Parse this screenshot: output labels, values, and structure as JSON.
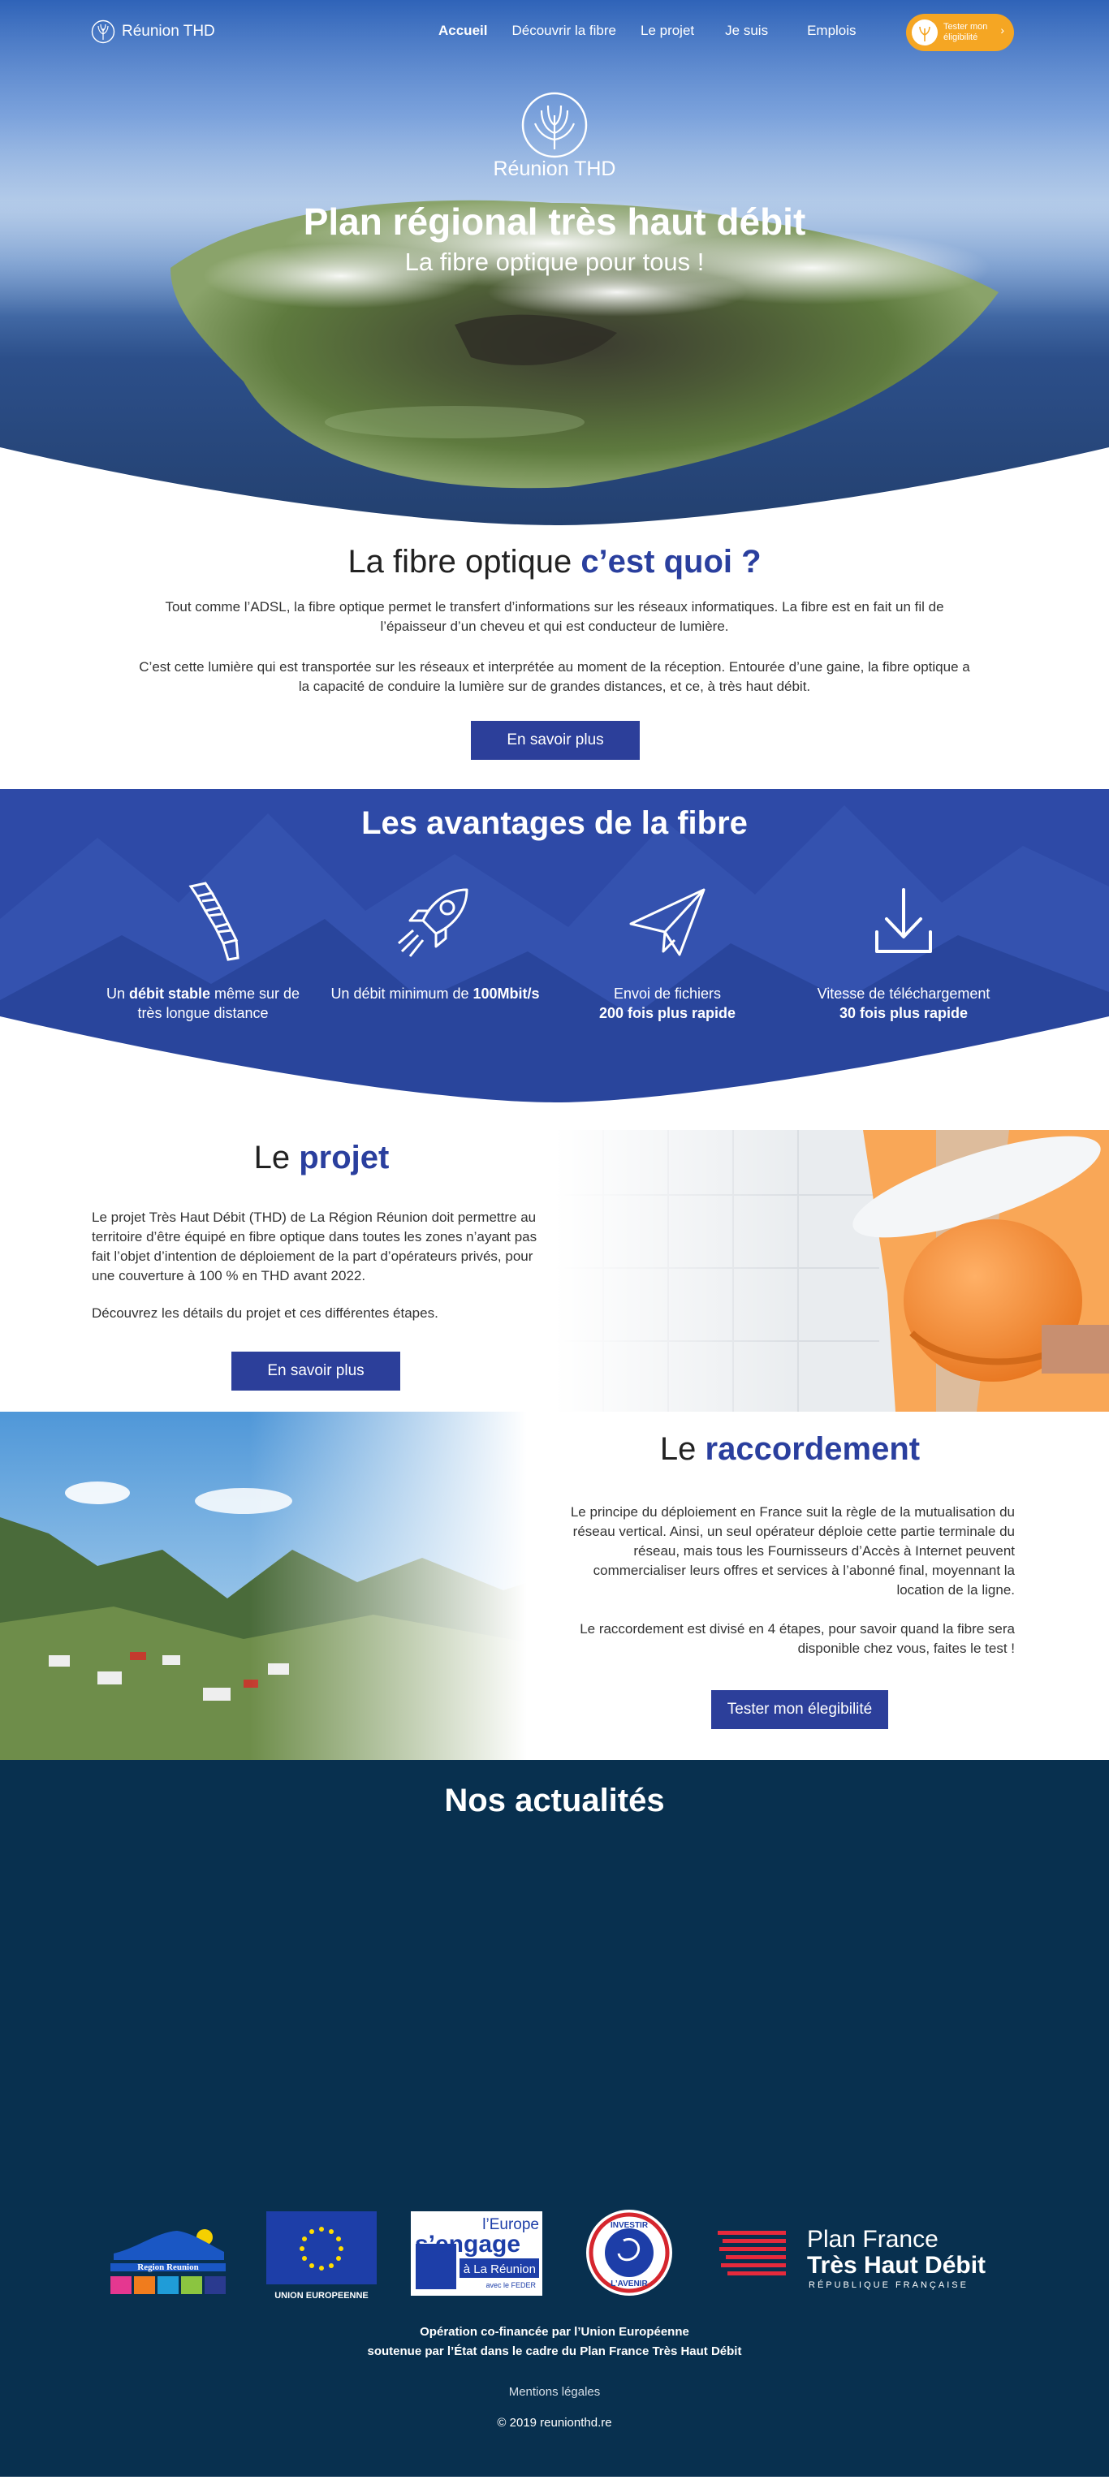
{
  "nav": {
    "brand": "Réunion THD",
    "links": [
      "Accueil",
      "Découvrir la fibre",
      "Le projet",
      "Je suis",
      "Emplois"
    ],
    "cta_line1": "Tester mon",
    "cta_line2": "éligibilité",
    "cta_arrow": "›"
  },
  "hero": {
    "logo_text": "Réunion THD",
    "title": "Plan régional très haut débit",
    "subtitle": "La fibre optique pour tous !"
  },
  "fibre": {
    "title_light": "La fibre optique ",
    "title_bold": "c’est quoi ?",
    "p1": "Tout comme l’ADSL, la fibre optique permet le transfert d’informations sur les réseaux informatiques. La fibre est en fait un fil de l’épaisseur d’un cheveu et qui est conducteur de lumière.",
    "p2": "C’est cette lumière qui est transportée sur les réseaux et interprétée au moment de la réception. Entourée d’une gaine, la fibre optique a la capacité de conduire la lumière sur de grandes distances, et ce, à très haut débit.",
    "button": "En savoir plus"
  },
  "avantages": {
    "title_light": "Les ",
    "title_bold": "avantages de la fibre",
    "items": [
      {
        "icon": "fiber-cable-icon",
        "pre": "Un ",
        "bold": "débit stable",
        "post": " même sur de très longue distance"
      },
      {
        "icon": "rocket-icon",
        "pre": "Un débit minimum de ",
        "bold": "100Mbit/s",
        "post": ""
      },
      {
        "icon": "paper-plane-icon",
        "pre": "Envoi de fichiers ",
        "bold": "200 fois plus rapide",
        "post": ""
      },
      {
        "icon": "download-icon",
        "pre": "Vitesse de téléchargement ",
        "bold": "30 fois plus rapide",
        "post": ""
      }
    ]
  },
  "projet": {
    "title_light": "Le ",
    "title_bold": "projet",
    "p1": "Le projet Très Haut Débit (THD) de La Région Réunion doit permettre au territoire d’être équipé en fibre optique dans toutes les zones n’ayant pas fait l’objet d’intention de déploiement de la part d’opérateurs privés, pour une couverture à 100 % en THD avant 2022.",
    "p2": "Découvrez les détails du projet et ces différentes étapes.",
    "button": "En savoir plus"
  },
  "raccordement": {
    "title_light": "Le ",
    "title_bold": "raccordement",
    "p1": "Le principe du déploiement en France suit la règle de la mutualisation du réseau vertical. Ainsi, un seul opérateur déploie cette partie terminale du réseau, mais tous les Fournisseurs d’Accès à Internet peuvent commercialiser leurs offres et services à l’abonné final, moyennant la location de la ligne.",
    "p2": "Le raccordement est divisé en 4 étapes, pour savoir quand la fibre sera disponible chez vous, faites le test !",
    "button": "Tester mon élegibilité"
  },
  "actualites": {
    "title_light": "Nos ",
    "title_bold": "actualités"
  },
  "partners": {
    "region": "Region Reunion",
    "ue": "UNION EUROPEENNE",
    "europe_1": "l’Europe",
    "europe_2": "s’engage",
    "europe_3": "à La Réunion",
    "europe_4": "avec le FEDER",
    "investir_top": "INVESTIR",
    "investir_bottom": "L’AVENIR",
    "plan_1": "Plan France",
    "plan_2": "Très Haut Débit",
    "plan_3": "RÉPUBLIQUE FRANÇAISE"
  },
  "footer": {
    "line1": "Opération co-financée par l’Union Européenne",
    "line2": "soutenue par l’État dans le cadre du Plan France Très Haut Débit",
    "legal": "Mentions légales",
    "copyright": "© 2019 reunionthd.re"
  },
  "colors": {
    "brand_blue": "#2c3f9a",
    "accent_orange": "#f5a623",
    "footer_navy": "#08304f"
  }
}
